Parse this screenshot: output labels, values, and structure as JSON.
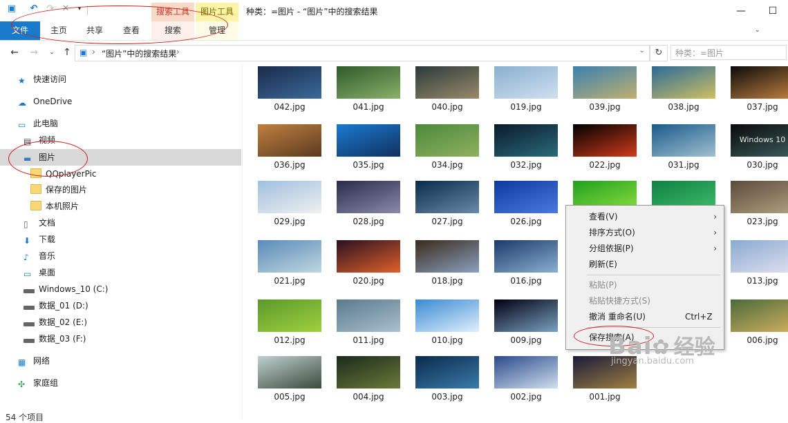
{
  "window": {
    "title": "种类：=图片 - “图片”中的搜索结果",
    "minimize": "—",
    "maximize": "☐"
  },
  "context_tabs": {
    "search_tools": "搜索工具",
    "picture_tools": "图片工具"
  },
  "ribbon_tabs": [
    "文件",
    "主页",
    "共享",
    "查看",
    "搜索",
    "管理"
  ],
  "address": {
    "path": "“图片”中的搜索结果",
    "search_placeholder": "种类：=图片"
  },
  "nav": {
    "quick_access": "快速访问",
    "onedrive": "OneDrive",
    "this_pc": "此电脑",
    "videos": "视频",
    "pictures": "图片",
    "sub_qq": "QQplayerPic",
    "sub_saved": "保存的图片",
    "sub_camera": "本机照片",
    "documents": "文档",
    "downloads": "下载",
    "music": "音乐",
    "desktop": "桌面",
    "drive_c": "Windows_10 (C:)",
    "drive_d": "数据_01 (D:)",
    "drive_e": "数据_02 (E:)",
    "drive_f": "数据_03 (F:)",
    "network": "网络",
    "homegroup": "家庭组"
  },
  "files": [
    [
      "042.jpg",
      "041.jpg",
      "040.jpg",
      "019.jpg",
      "039.jpg",
      "038.jpg",
      "037.jpg"
    ],
    [
      "036.jpg",
      "035.jpg",
      "034.jpg",
      "032.jpg",
      "022.jpg",
      "031.jpg",
      "030.jpg"
    ],
    [
      "029.jpg",
      "028.jpg",
      "027.jpg",
      "026.jpg",
      "",
      "",
      "023.jpg"
    ],
    [
      "021.jpg",
      "020.jpg",
      "018.jpg",
      "016.jpg",
      "",
      "",
      "013.jpg"
    ],
    [
      "012.jpg",
      "011.jpg",
      "010.jpg",
      "009.jpg",
      "",
      "",
      "006.jpg"
    ],
    [
      "005.jpg",
      "004.jpg",
      "003.jpg",
      "002.jpg",
      "001.jpg",
      "",
      ""
    ]
  ],
  "thumb_text": {
    "windows10": "Windows 10"
  },
  "context_menu": {
    "view": "查看(V)",
    "sort": "排序方式(O)",
    "group": "分组依据(P)",
    "refresh": "刷新(E)",
    "paste": "粘贴(P)",
    "paste_shortcut": "粘贴快捷方式(S)",
    "undo_rename": "撤消 重命名(U)",
    "undo_shortcut": "Ctrl+Z",
    "save_search": "保存搜索(A)"
  },
  "status": "54 个项目",
  "watermark": {
    "brand": "Bai",
    "brand2": "经验",
    "url": "jingyan.baidu.com"
  },
  "colors": {
    "file_tab": "#1979ca",
    "highlight_ring": "#d01c1c",
    "selected_nav": "#d9d9d9"
  }
}
